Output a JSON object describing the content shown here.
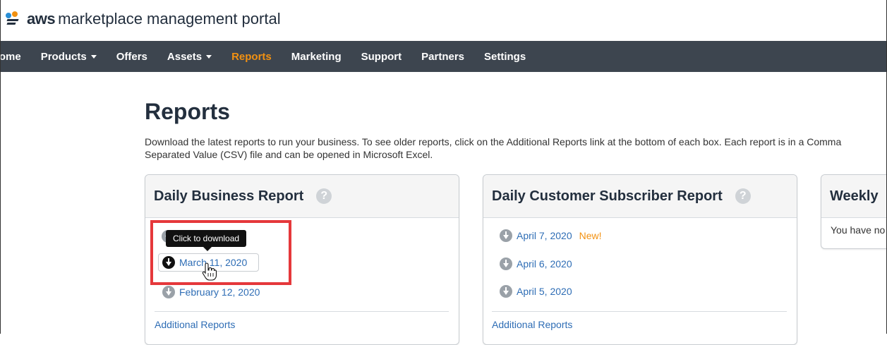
{
  "header": {
    "logo_bold": "aws",
    "logo_text": "marketplace management portal"
  },
  "nav": {
    "items": [
      {
        "label": "Home",
        "has_caret": false,
        "active": false
      },
      {
        "label": "Products",
        "has_caret": true,
        "active": false
      },
      {
        "label": "Offers",
        "has_caret": false,
        "active": false
      },
      {
        "label": "Assets",
        "has_caret": true,
        "active": false
      },
      {
        "label": "Reports",
        "has_caret": false,
        "active": true
      },
      {
        "label": "Marketing",
        "has_caret": false,
        "active": false
      },
      {
        "label": "Support",
        "has_caret": false,
        "active": false
      },
      {
        "label": "Partners",
        "has_caret": false,
        "active": false
      },
      {
        "label": "Settings",
        "has_caret": false,
        "active": false
      }
    ]
  },
  "page": {
    "title": "Reports",
    "description": "Download the latest reports to run your business. To see older reports, click on the Additional Reports link at the bottom of each box. Each report is in a Comma Separated Value (CSV) file and can be opened in Microsoft Excel."
  },
  "cards": {
    "daily_business": {
      "title": "Daily Business Report",
      "help_icon": "question-mark-icon",
      "tooltip": "Click to download",
      "reports": [
        "March 11, 2020",
        "February 12, 2020"
      ],
      "additional": "Additional Reports"
    },
    "daily_customer": {
      "title": "Daily Customer Subscriber Report",
      "help_icon": "question-mark-icon",
      "reports": [
        "April 7, 2020",
        "April 6, 2020",
        "April 5, 2020"
      ],
      "new_badge": "New!",
      "additional": "Additional Reports"
    },
    "weekly": {
      "title": "Weekly",
      "body": "You have no"
    }
  },
  "colors": {
    "navbar_bg": "#3d454f",
    "active_nav": "#f29111",
    "link": "#2e6db5",
    "highlight": "#e5383b"
  }
}
